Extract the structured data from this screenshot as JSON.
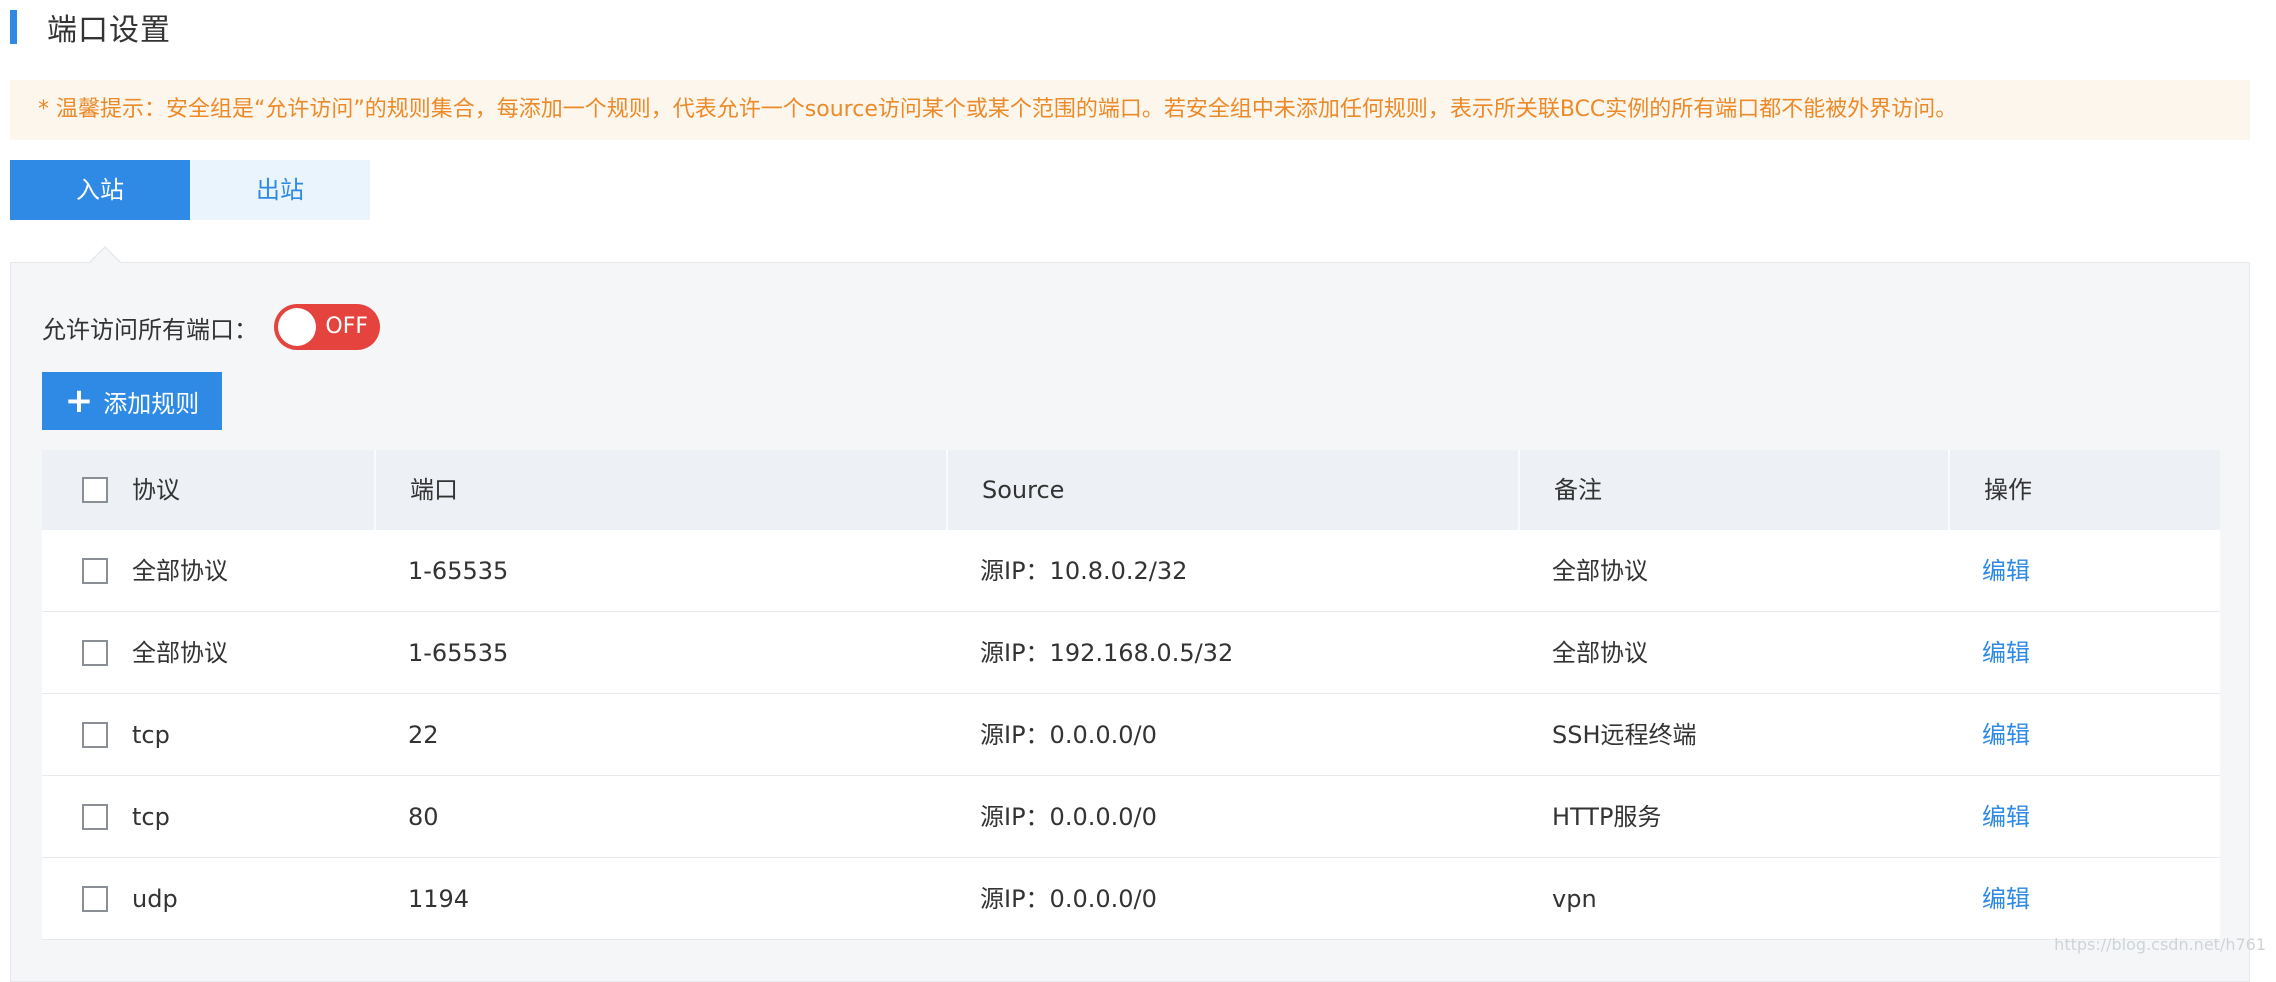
{
  "header": {
    "title": "端口设置"
  },
  "tip": {
    "text": "* 温馨提示：安全组是“允许访问”的规则集合，每添加一个规则，代表允许一个source访问某个或某个范围的端口。若安全组中未添加任何规则，表示所关联BCC实例的所有端口都不能被外界访问。"
  },
  "tabs": [
    {
      "label": "入站",
      "active": true
    },
    {
      "label": "出站",
      "active": false
    }
  ],
  "allow_all": {
    "label": "允许访问所有端口：",
    "state": "OFF"
  },
  "add_rule": {
    "label": "添加规则",
    "icon": "plus-icon"
  },
  "table": {
    "columns": [
      "协议",
      "端口",
      "Source",
      "备注",
      "操作"
    ],
    "rows": [
      {
        "protocol": "全部协议",
        "port": "1-65535",
        "source": "源IP：10.8.0.2/32",
        "remark": "全部协议",
        "action": "编辑"
      },
      {
        "protocol": "全部协议",
        "port": "1-65535",
        "source": "源IP：192.168.0.5/32",
        "remark": "全部协议",
        "action": "编辑"
      },
      {
        "protocol": "tcp",
        "port": "22",
        "source": "源IP：0.0.0.0/0",
        "remark": "SSH远程终端",
        "action": "编辑"
      },
      {
        "protocol": "tcp",
        "port": "80",
        "source": "源IP：0.0.0.0/0",
        "remark": "HTTP服务",
        "action": "编辑"
      },
      {
        "protocol": "udp",
        "port": "1194",
        "source": "源IP：0.0.0.0/0",
        "remark": "vpn",
        "action": "编辑"
      }
    ]
  },
  "watermark": "https://blog.csdn.net/h761",
  "colors": {
    "accent": "#2f8ae5",
    "tip_text": "#ec8a2a",
    "tip_bg": "#fdf6ec",
    "toggle_off": "#e5433e"
  }
}
